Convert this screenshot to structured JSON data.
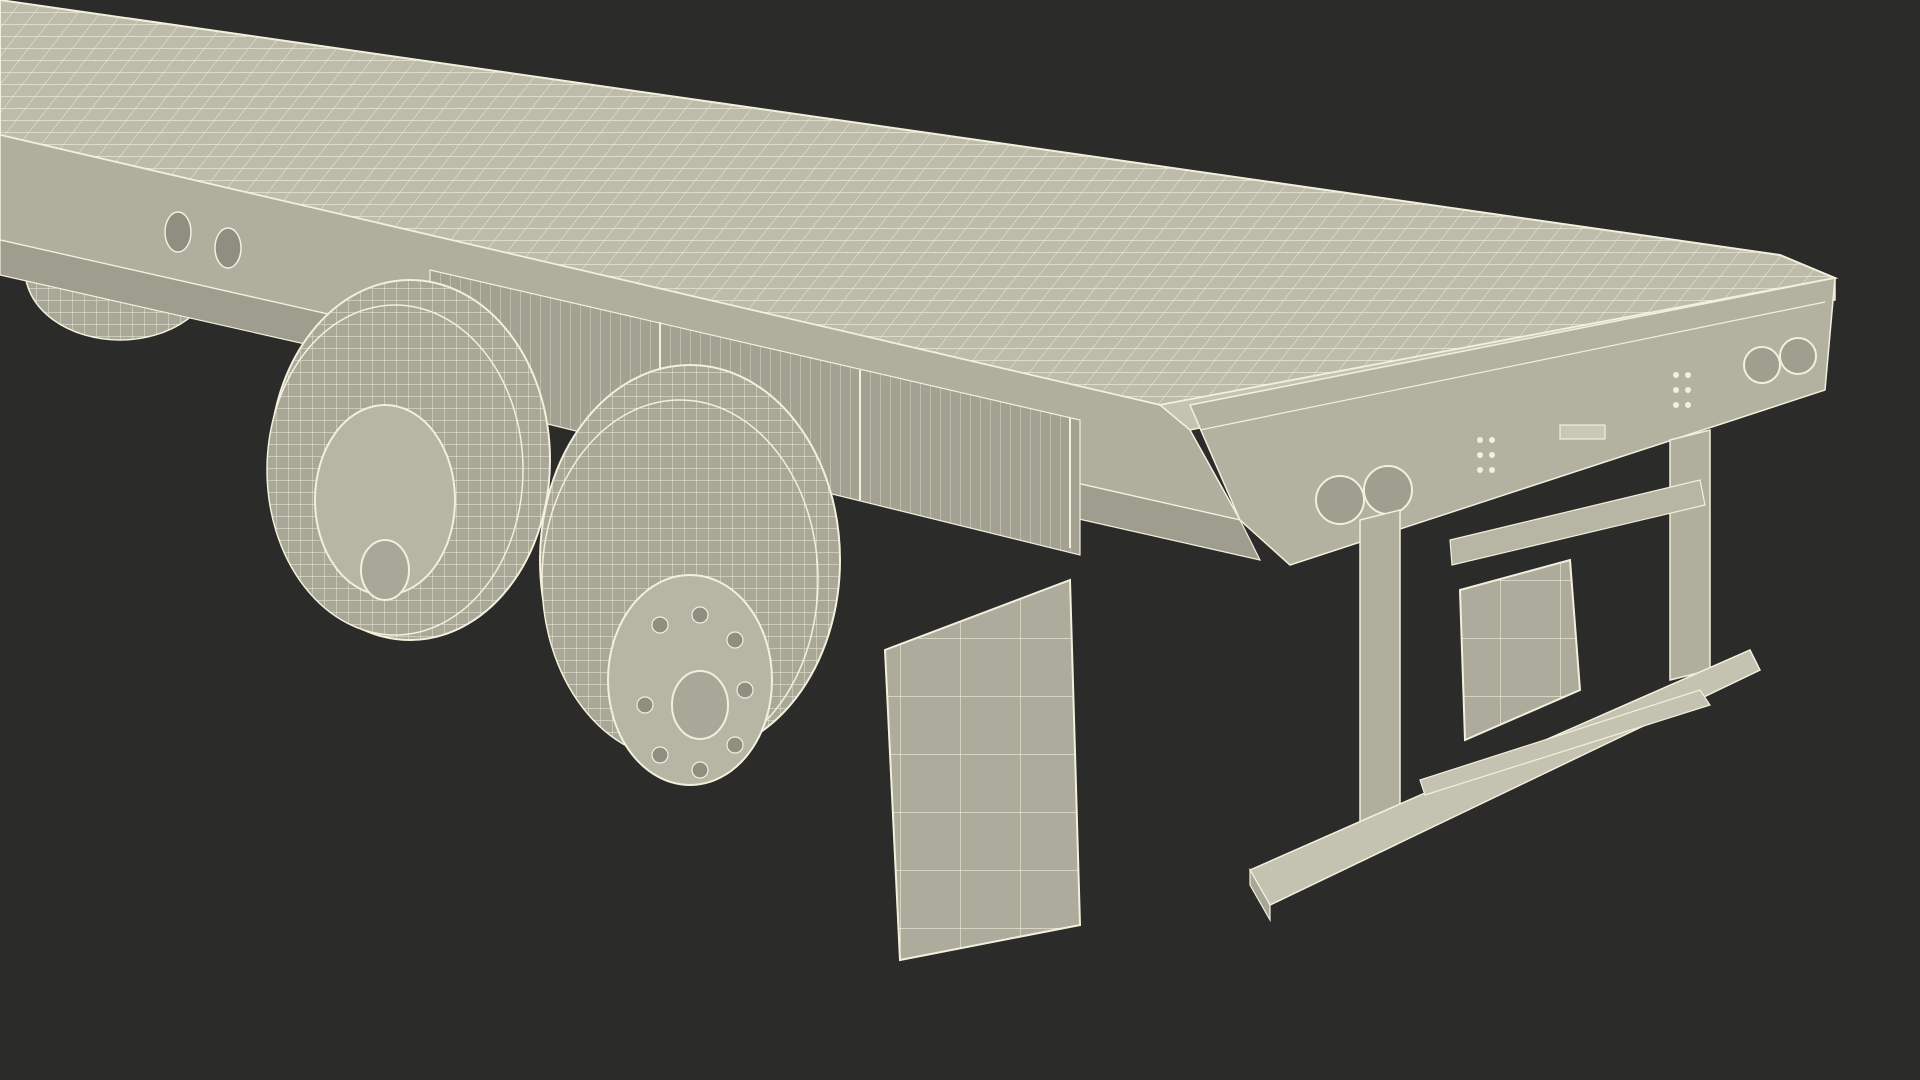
{
  "scene": {
    "subject": "flatbed-semi-trailer-wireframe-render",
    "colors": {
      "background": "#2b2b2a",
      "surface": "#b9b8a6",
      "surface_light": "#c9c8b6",
      "surface_dark": "#8f8e80",
      "wire": "#f2f0dc",
      "shadow": "#6f6e64"
    }
  }
}
